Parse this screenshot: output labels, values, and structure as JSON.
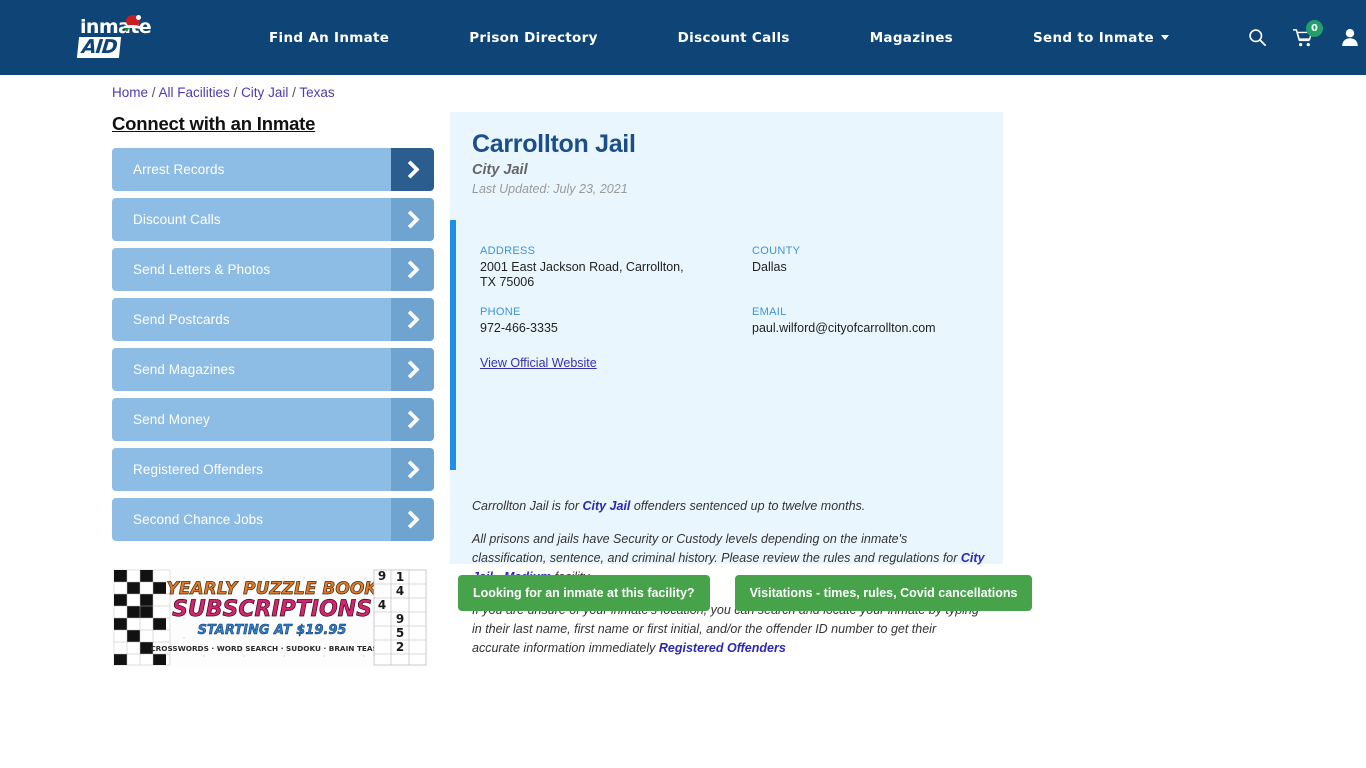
{
  "header": {
    "logo": {
      "part1": "inmate",
      "part2": "AID",
      "icon": "santa-hat-icon"
    },
    "nav_items": [
      {
        "label": "Find An Inmate",
        "dropdown": false
      },
      {
        "label": "Prison Directory",
        "dropdown": false
      },
      {
        "label": "Discount Calls",
        "dropdown": false
      },
      {
        "label": "Magazines",
        "dropdown": false
      },
      {
        "label": "Send to Inmate",
        "dropdown": true
      }
    ],
    "icons": {
      "search": "search-icon",
      "cart": "shopping-cart-icon",
      "cart_badge": "0",
      "account": "user-account-icon"
    },
    "background_color": "#0E4576",
    "badge_color": "#22A06B"
  },
  "breadcrumb": {
    "items": [
      "Home",
      "All Facilities",
      "City Jail",
      "Texas"
    ],
    "separator": "/"
  },
  "sidebar": {
    "title": "Connect with an Inmate",
    "items": [
      {
        "label": "Arrest Records",
        "active": true
      },
      {
        "label": "Discount Calls",
        "active": false
      },
      {
        "label": "Send Letters & Photos",
        "active": false
      },
      {
        "label": "Send Postcards",
        "active": false
      },
      {
        "label": "Send Magazines",
        "active": false
      },
      {
        "label": "Send Money",
        "active": false
      },
      {
        "label": "Registered Offenders",
        "active": false
      },
      {
        "label": "Second Chance Jobs",
        "active": false
      }
    ],
    "button_color": "#8DBCE4",
    "arrow_color": "#6FA3D0",
    "arrow_active_color": "#2C5D8F"
  },
  "ad": {
    "line1": "YEARLY PUZZLE BOOK",
    "line2": "SUBSCRIPTIONS",
    "line3": "STARTING AT $19.95",
    "line4": "CROSSWORDS · WORD SEARCH · SUDOKU · BRAIN TEASERS",
    "sudoku_digits": [
      "1",
      "4",
      "4",
      "9",
      "5",
      "2"
    ]
  },
  "facility": {
    "name": "Carrollton Jail",
    "type": "City Jail",
    "last_updated": "Last Updated: July 23, 2021",
    "fields": {
      "address_label": "ADDRESS",
      "address_value": "2001 East Jackson Road, Carrollton, TX 75006",
      "county_label": "COUNTY",
      "county_value": "Dallas",
      "phone_label": "PHONE",
      "phone_value": "972-466-3335",
      "email_label": "EMAIL",
      "email_value": "paul.wilford@cityofcarrollton.com"
    },
    "official_website_link": "View Official Website",
    "accent_color": "#1E90E8",
    "card_background": "#EAF6FD"
  },
  "description": {
    "p1_a": "Carrollton Jail is for ",
    "p1_link": "City Jail",
    "p1_b": " offenders sentenced up to twelve months.",
    "p2_a": "All prisons and jails have Security or Custody levels depending on the inmate's classification, sentence, and criminal history. Please review the rules and regulations for ",
    "p2_link": "City Jail - Medium",
    "p2_b": " facility.",
    "p3_a": "If you are unsure of your inmate's location, you can search and locate your inmate by typing in their last name, first name or first initial, and/or the offender ID number to get their accurate information immediately ",
    "p3_link": "Registered Offenders"
  },
  "cta_buttons": [
    {
      "label": "Looking for an inmate at this facility?"
    },
    {
      "label": "Visitations - times, rules, Covid cancellations"
    }
  ],
  "colors": {
    "cta_green": "#46A34A",
    "link_purple": "#4B3CB0",
    "link_blue": "#2A28B8"
  }
}
